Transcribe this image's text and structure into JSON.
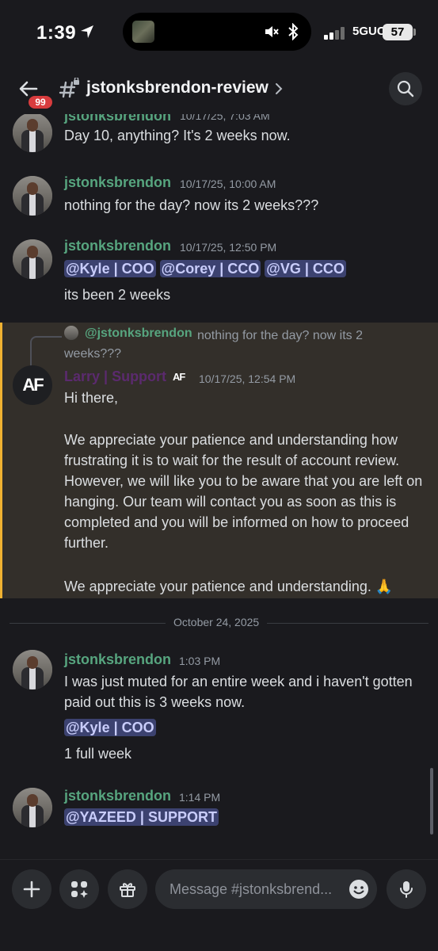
{
  "status_bar": {
    "time": "1:39",
    "network": "5GUC",
    "battery": "57"
  },
  "header": {
    "badge": "99",
    "channel": "jstonksbrendon-review"
  },
  "messages": [
    {
      "user": "jstonksbrendon",
      "time": "10/17/25, 7:03 AM",
      "text": "Day 10, anything? It's 2 weeks now."
    },
    {
      "user": "jstonksbrendon",
      "time": "10/17/25, 10:00 AM",
      "text": "nothing for the day? now its 2 weeks???"
    },
    {
      "user": "jstonksbrendon",
      "time": "10/17/25, 12:50 PM",
      "mentions": [
        "@Kyle | COO",
        "@Corey | CCO",
        "@VG | CCO"
      ],
      "text": "its been 2 weeks"
    },
    {
      "reply_user": "@jstonksbrendon",
      "reply_text": "nothing for the day? now its 2 weeks???",
      "user": "Larry | Support",
      "tag": "AF",
      "avatar_text": "AF",
      "time": "10/17/25, 12:54 PM",
      "paragraphs": [
        "Hi there,",
        "We appreciate your patience and understanding how frustrating it is to wait for the result of account review. However, we will like you to be aware that you are left on hanging. Our team will contact you as soon as this is completed and you will be informed on how to proceed further.",
        "We appreciate your patience and understanding. 🙏"
      ]
    },
    {
      "user": "jstonksbrendon",
      "time": "1:03 PM",
      "text": "I was just muted for an entire week and i haven't gotten paid out this is 3 weeks now.",
      "mention": "@Kyle | COO",
      "text2": "1 full week"
    },
    {
      "user": "jstonksbrendon",
      "time": "1:14 PM",
      "mention": "@YAZEED | SUPPORT"
    }
  ],
  "date_divider": "October 24, 2025",
  "composer": {
    "placeholder": "Message #jstonksbrend..."
  }
}
